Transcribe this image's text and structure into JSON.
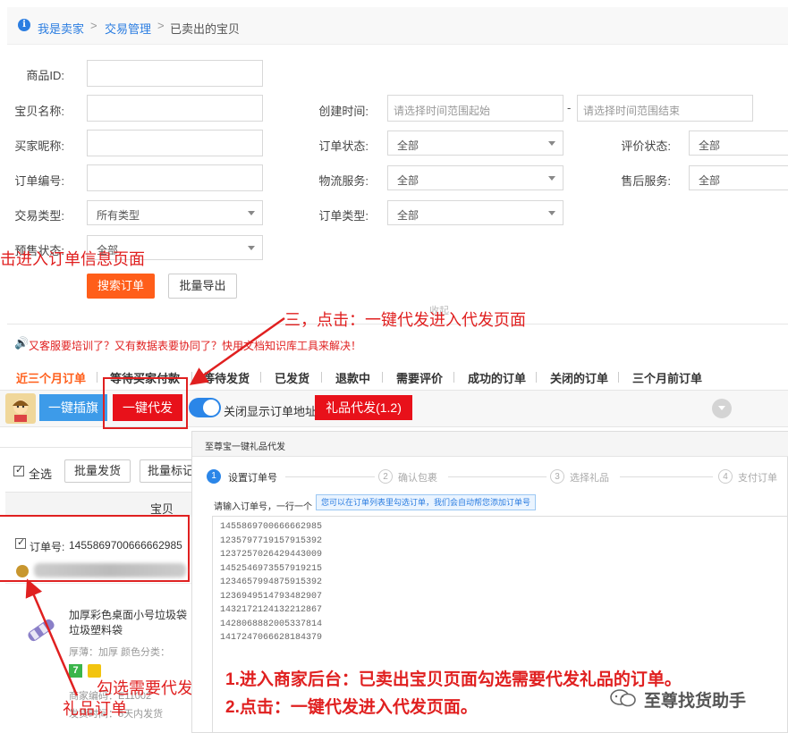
{
  "breadcrumb": {
    "seller": "我是卖家",
    "trade": "交易管理",
    "current": "已卖出的宝贝",
    "sep": ">"
  },
  "form": {
    "product_id_label": "商品ID:",
    "item_name_label": "宝贝名称:",
    "buyer_nick_label": "买家昵称:",
    "order_no_label": "订单编号:",
    "trade_type_label": "交易类型:",
    "trade_type_value": "所有类型",
    "presale_label": "预售状态:",
    "presale_value": "全部",
    "created_label": "创建时间:",
    "time_start_placeholder": "请选择时间范围起始",
    "time_dash": "-",
    "time_end_placeholder": "请选择时间范围结束",
    "order_status_label": "订单状态:",
    "order_status_value": "全部",
    "logistics_label": "物流服务:",
    "logistics_value": "全部",
    "order_type_label": "订单类型:",
    "order_type_value": "全部",
    "review_label": "评价状态:",
    "review_value": "全部",
    "after_sale_label": "售后服务:",
    "after_sale_value": "全部",
    "search_btn": "搜索订单",
    "export_btn": "批量导出",
    "collapse_text": "收起"
  },
  "annotations": {
    "top_left": "击进入订单信息页面",
    "step3": "三，点击：一键代发进入代发页面",
    "check_orders_1": "勾选需要代发",
    "check_orders_2": "礼品订单",
    "bottom_1": "1.进入商家后台：已卖出宝贝页面勾选需要代发礼品的订单。",
    "bottom_2": "2.点击：一键代发进入代发页面。"
  },
  "notice": "又客服要培训了？又有数据表要协同了？快用文档知识库工具来解决！",
  "tabs": [
    "近三个月订单",
    "等待买家付款",
    "等待发货",
    "已发货",
    "退款中",
    "需要评价",
    "成功的订单",
    "关闭的订单",
    "三个月前订单"
  ],
  "toolbar": {
    "flag_btn": "一键插旗",
    "dispatch_btn": "一键代发",
    "toggle_label": "关闭显示订单地址",
    "gift_btn": "礼品代发(1.2)"
  },
  "list": {
    "select_all": "全选",
    "batch_ship": "批量发货",
    "batch_mark": "批量标记",
    "col_item": "宝贝",
    "order_no_label": "订单号:",
    "order_no": "1455869700666662985",
    "product_title_1": "加厚彩色桌面小号垃圾袋",
    "product_title_2": "垃圾塑料袋",
    "product_spec": "厚薄：加厚  颜色分类：",
    "merchant_code": "商家编码：E11002",
    "ship_time": "发货时间：5天内发货"
  },
  "modal": {
    "title": "至尊宝一键礼品代发",
    "steps": [
      {
        "num": "1",
        "label": "设置订单号",
        "active": true
      },
      {
        "num": "2",
        "label": "确认包裹",
        "active": false
      },
      {
        "num": "3",
        "label": "选择礼品",
        "active": false
      },
      {
        "num": "4",
        "label": "支付订单",
        "active": false
      }
    ],
    "input_prompt": "请输入订单号，一行一个",
    "hint": "您可以在订单列表里勾选订单，我们会自动帮您添加订单号",
    "orders": [
      "1455869700666662985",
      "1235797719157915392",
      "1237257026429443009",
      "1452546973557919215",
      "1234657994875915392",
      "1236949514793482907",
      "1432172124132212867",
      "1428068882005337814",
      "1417247066628184379"
    ]
  },
  "watermark": "至尊找货助手",
  "colors": {
    "accent_orange": "#ff5e1a",
    "annotation_red": "#e02020",
    "link_blue": "#2b7de1",
    "button_blue": "#3d9be9"
  }
}
